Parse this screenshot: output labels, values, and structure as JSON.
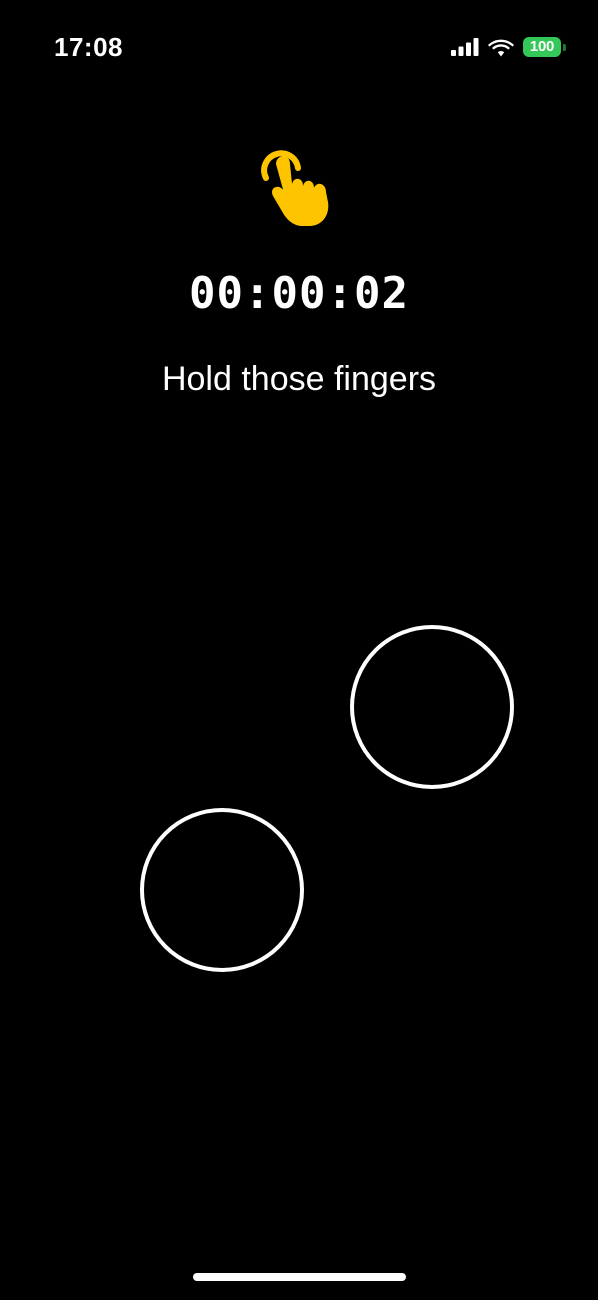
{
  "status_bar": {
    "time": "17:08",
    "battery_level": "100",
    "battery_color": "#34c759",
    "icons": [
      "cellular-signal-icon",
      "wifi-icon",
      "battery-icon"
    ]
  },
  "main": {
    "icon": "tapping-hand-icon",
    "icon_color": "#ffc400",
    "timer": "00:00:02",
    "instruction": "Hold those fingers",
    "active_touches": 2
  }
}
